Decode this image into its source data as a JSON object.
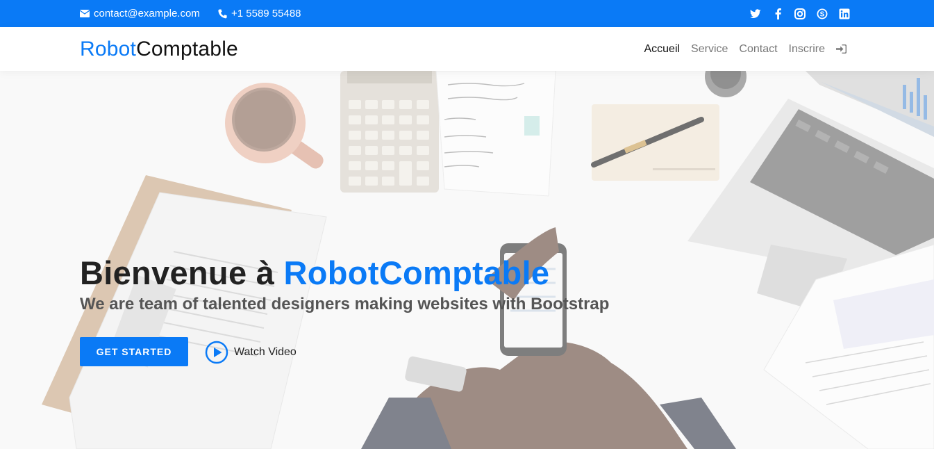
{
  "topbar": {
    "email": "contact@example.com",
    "phone": "+1 5589 55488",
    "social_icons": [
      "twitter-icon",
      "facebook-icon",
      "instagram-icon",
      "skype-icon",
      "linkedin-icon"
    ]
  },
  "header": {
    "logo_part1": "Robot",
    "logo_part2": "Comptable",
    "nav": [
      {
        "label": "Accueil",
        "active": true
      },
      {
        "label": "Service",
        "active": false
      },
      {
        "label": "Contact",
        "active": false
      },
      {
        "label": "Inscrire",
        "active": false
      }
    ],
    "login_icon": "sign-in-icon"
  },
  "hero": {
    "title_prefix": "Bienvenue à ",
    "title_accent": "RobotComptable",
    "subtitle": "We are team of talented designers making websites with Bootstrap",
    "cta_label": "GET STARTED",
    "video_label": "Watch Video"
  },
  "colors": {
    "accent": "#0a7af6",
    "topbar_bg": "#0a7af6",
    "heading": "#222222",
    "nav_inactive": "#777777"
  }
}
